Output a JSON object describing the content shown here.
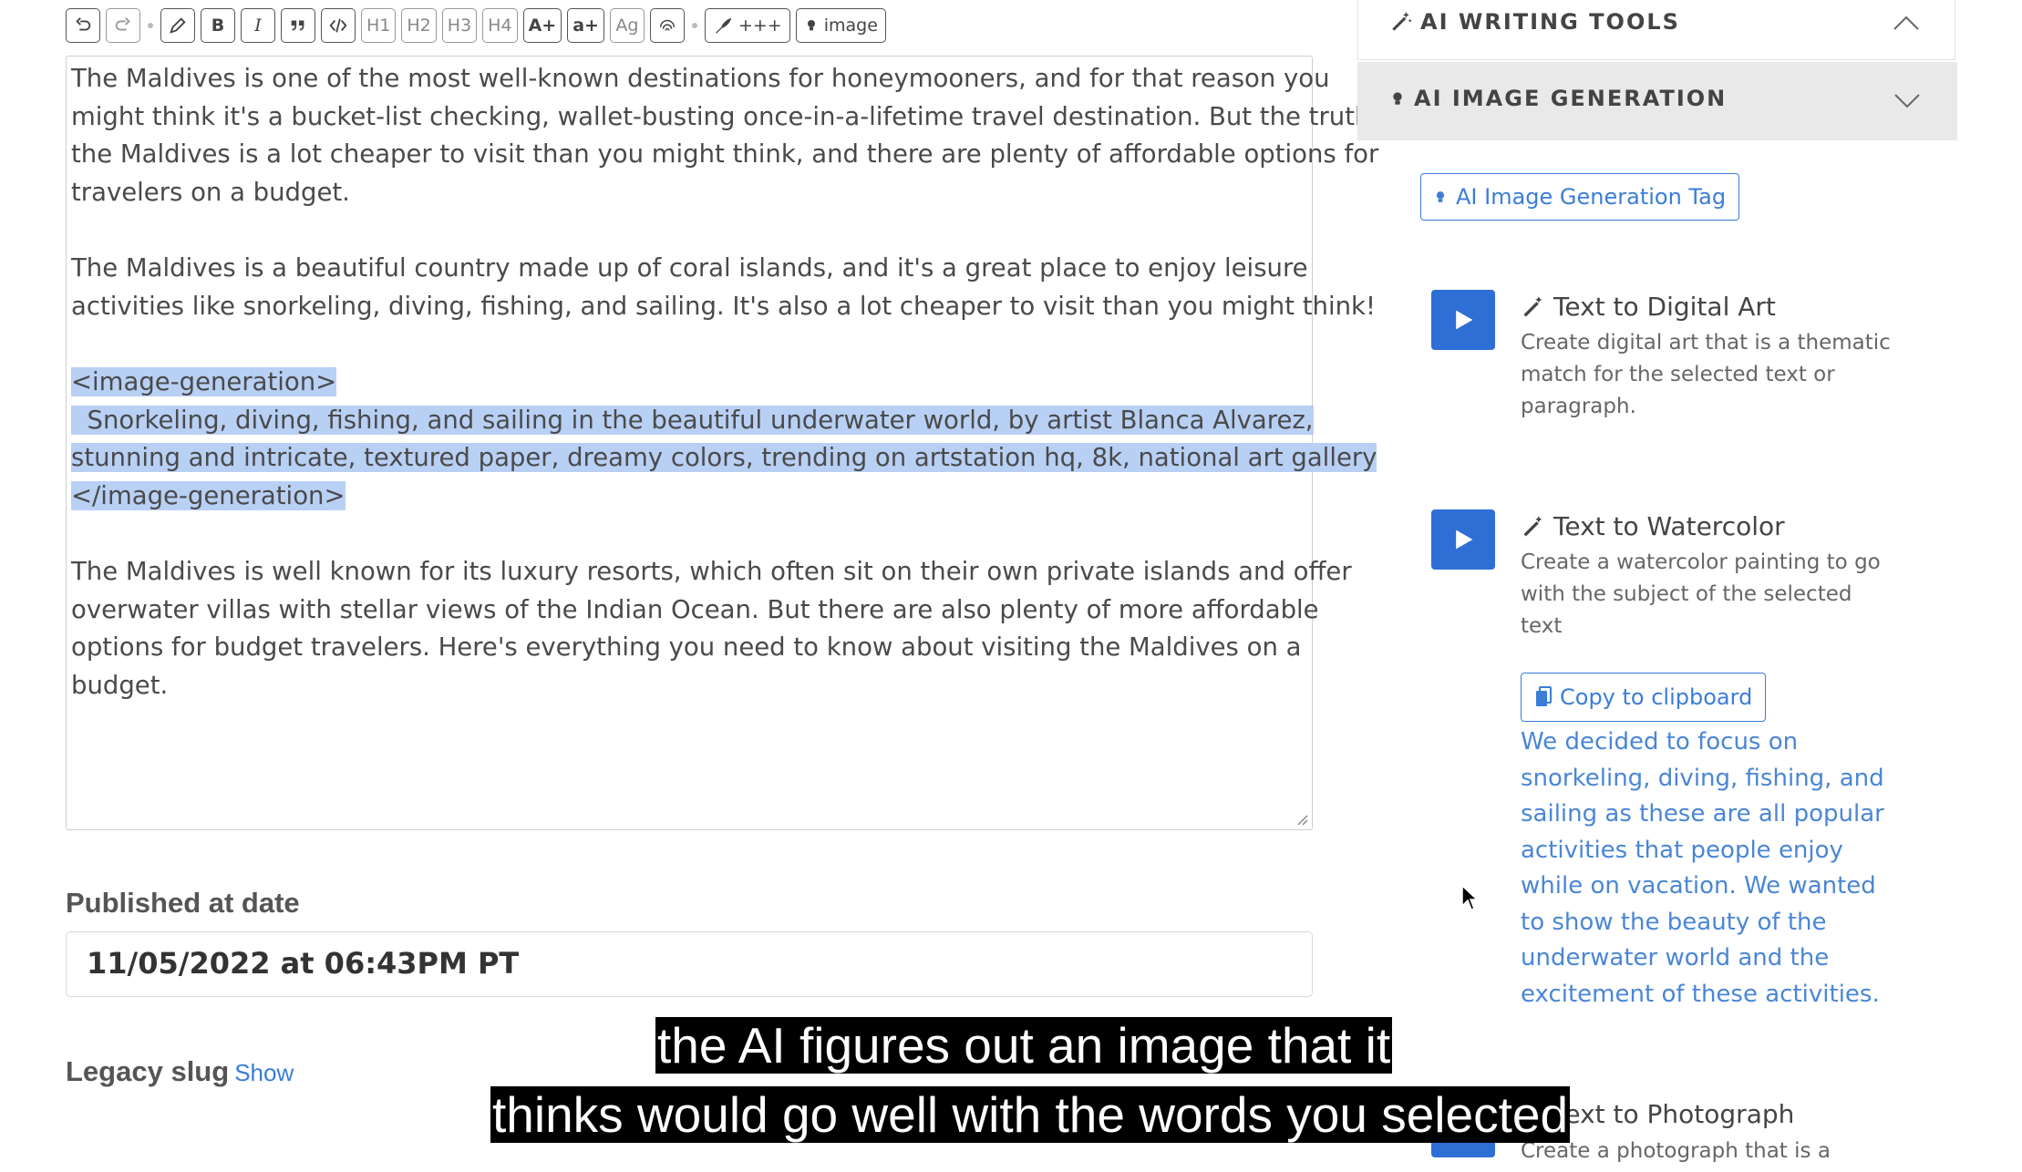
{
  "toolbar": {
    "buttons": [
      "undo-icon",
      "redo-icon",
      "pencil-icon",
      "B",
      "I",
      "quote-icon",
      "code-icon",
      "H1",
      "H2",
      "H3",
      "H4",
      "A+",
      "a+",
      "Ag",
      "fingerprint-icon"
    ],
    "more_label": "+++",
    "image_label": "image"
  },
  "editor": {
    "paragraphs": [
      [
        "The Maldives is one of the most well-known destinations for honeymooners, and for that reason you",
        "might think it's a bucket-list checking, wallet-busting once-in-a-lifetime travel destination. But the truth is,",
        "the Maldives is a lot cheaper to visit than you might think, and there are plenty of affordable options for",
        "travelers on a budget."
      ],
      [
        "The Maldives is a beautiful country made up of coral islands, and it's a great place to enjoy leisure",
        "activities like snorkeling, diving, fishing, and sailing. It's also a lot cheaper to visit than you might think!"
      ],
      [
        "<image-generation>",
        "  Snorkeling, diving, fishing, and sailing in the beautiful underwater world, by artist Blanca Alvarez,",
        "stunning and intricate, textured paper, dreamy colors, trending on artstation hq, 8k, national art gallery",
        "</image-generation>"
      ],
      [
        "The Maldives is well known for its luxury resorts, which often sit on their own private islands and offer",
        "overwater villas with stellar views of the Indian Ocean. But there are also plenty of more affordable",
        "options for budget travelers. Here's everything you need to know about visiting the Maldives on a",
        "budget."
      ]
    ]
  },
  "published": {
    "label": "Published at date",
    "value": "11/05/2022 at 06:43PM PT"
  },
  "legacy_slug": {
    "label": "Legacy slug",
    "link": "Show"
  },
  "sidebar": {
    "writing_tools_title": "AI WRITING TOOLS",
    "image_generation_title": "AI IMAGE GENERATION",
    "tag_button": "AI Image Generation Tag",
    "tools": [
      {
        "title": "Text to Digital Art",
        "desc": [
          "Create digital art that is a thematic",
          "match for the selected text or",
          "paragraph."
        ]
      },
      {
        "title": "Text to Watercolor",
        "desc": [
          "Create a watercolor painting to go",
          "with the subject of the selected",
          "text"
        ]
      },
      {
        "title": "Text to Photograph",
        "desc": [
          "Create a photograph that is a"
        ]
      }
    ],
    "copy_button": "Copy to clipboard",
    "result_lines": [
      "We decided to focus on",
      "snorkeling, diving, fishing, and",
      "sailing as these are all popular",
      "activities that people enjoy",
      "while on vacation. We wanted",
      "to show the beauty of the",
      "underwater world and the",
      "excitement of these activities."
    ]
  },
  "caption": {
    "line1": "the AI figures out an image that it",
    "line2": "thinks would go well with the words you selected"
  },
  "colors": {
    "accent": "#2e6fd6",
    "link": "#3b7dd8",
    "highlight": "#b9d0f5",
    "result_text": "#4a86d6"
  }
}
